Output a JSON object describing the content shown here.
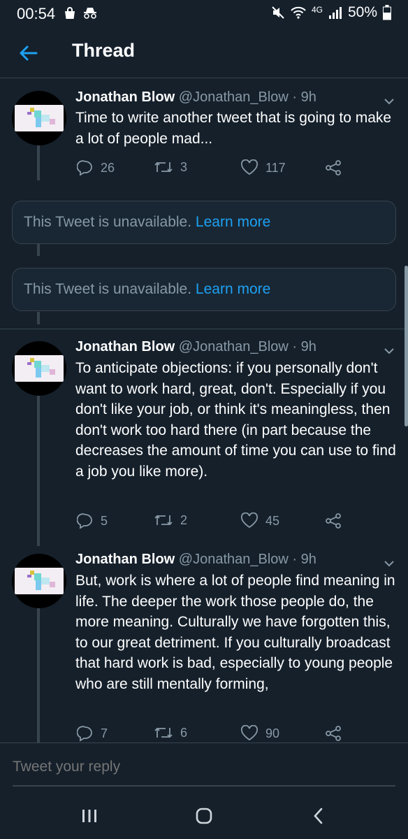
{
  "status": {
    "time": "00:54",
    "battery": "50%",
    "network": "4G"
  },
  "header": {
    "title": "Thread"
  },
  "tweets": [
    {
      "name": "Jonathan Blow",
      "handle": "@Jonathan_Blow · 9h",
      "text": "Time to write another tweet that is going to make a lot of people mad...",
      "replies": "26",
      "retweets": "3",
      "likes": "117"
    },
    {
      "name": "Jonathan Blow",
      "handle": "@Jonathan_Blow · 9h",
      "text": "To anticipate objections: if you personally don't want to work hard, great, don't. Especially if you don't like your job, or think it's meaningless, then don't work too hard there (in part because the decreases the amount of time you can use to find a job you like more).",
      "replies": "5",
      "retweets": "2",
      "likes": "45"
    },
    {
      "name": "Jonathan Blow",
      "handle": "@Jonathan_Blow · 9h",
      "text": "But, work is where a lot of people find meaning in life. The deeper the work those people do, the more meaning. Culturally we have forgotten this, to our great detriment. If you culturally broadcast that hard work is bad, especially to young people who are still mentally forming,",
      "replies": "7",
      "retweets": "6",
      "likes": "90"
    }
  ],
  "unavailable": [
    {
      "text": "This Tweet is unavailable.",
      "link": "Learn more"
    },
    {
      "text": "This Tweet is unavailable.",
      "link": "Learn more"
    }
  ],
  "reply": {
    "placeholder": "Tweet your reply"
  },
  "colors": {
    "background": "#15202b",
    "accent": "#1da1f2",
    "muted": "#8899a6",
    "border": "#38444d"
  }
}
